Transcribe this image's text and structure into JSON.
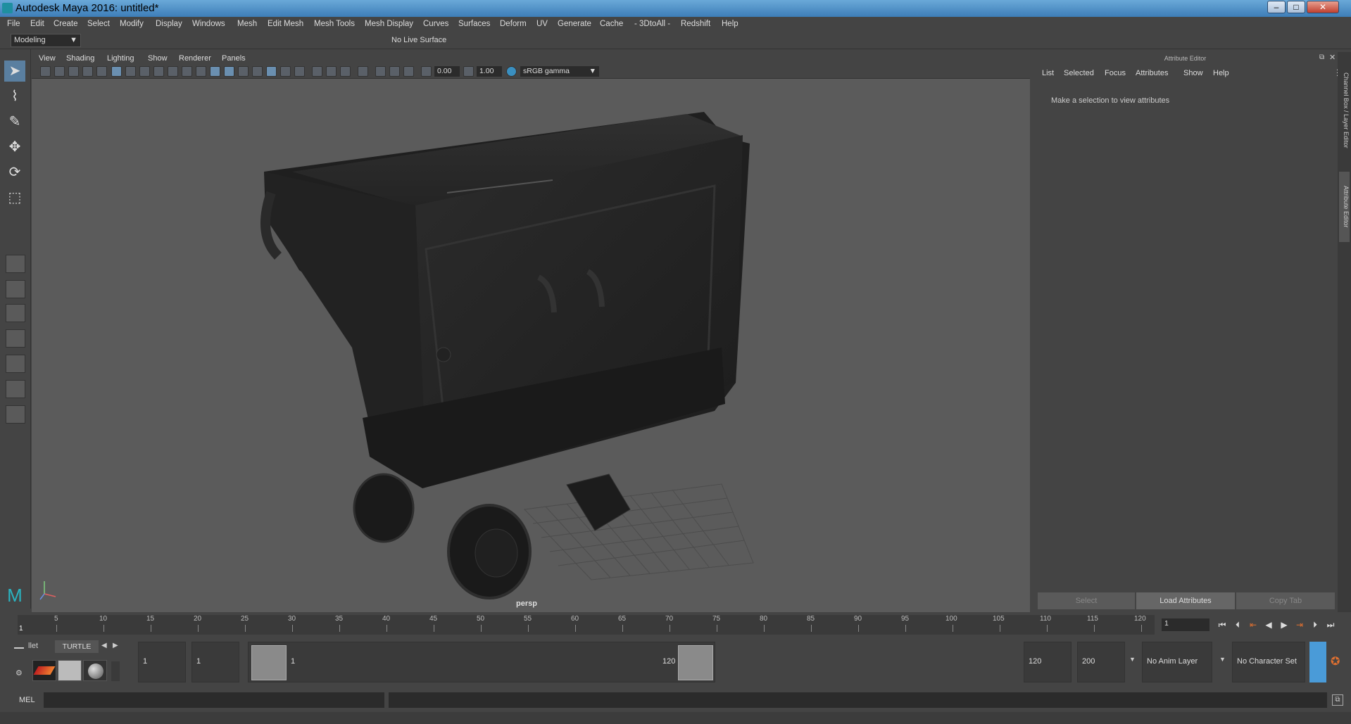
{
  "window": {
    "title": "Autodesk Maya 2016: untitled*"
  },
  "menus": [
    "File",
    "Edit",
    "Create",
    "Select",
    "Modify",
    "Display",
    "Windows",
    "Mesh",
    "Edit Mesh",
    "Mesh Tools",
    "Mesh Display",
    "Curves",
    "Surfaces",
    "Deform",
    "UV",
    "Generate",
    "Cache",
    "- 3DtoAll -",
    "Redshift",
    "Help"
  ],
  "shelf": {
    "mode": "Modeling",
    "live_surface": "No Live Surface"
  },
  "viewport": {
    "menus": [
      "View",
      "Shading",
      "Lighting",
      "Show",
      "Renderer",
      "Panels"
    ],
    "exposure": "0.00",
    "gamma": "1.00",
    "colorspace": "sRGB gamma",
    "camera": "persp"
  },
  "attribute_editor": {
    "header": "Attribute Editor",
    "tabs": [
      "List",
      "Selected",
      "Focus",
      "Attributes",
      "Show",
      "Help"
    ],
    "message": "Make a selection to view attributes",
    "buttons": [
      "Select",
      "Load Attributes",
      "Copy Tab"
    ]
  },
  "side_tabs": [
    "Channel Box / Layer Editor",
    "Attribute Editor"
  ],
  "timeline": {
    "ticks": [
      "5",
      "10",
      "15",
      "20",
      "25",
      "30",
      "35",
      "40",
      "45",
      "50",
      "55",
      "60",
      "65",
      "70",
      "75",
      "80",
      "85",
      "90",
      "95",
      "100",
      "105",
      "110",
      "115",
      "120"
    ],
    "current_frame_marker": "1",
    "current_frame": "1"
  },
  "range": {
    "shelf_tab1": "llet",
    "shelf_tab2": "TURTLE",
    "start": "1",
    "anim_start": "1",
    "range_start": "1",
    "range_end": "120",
    "end": "120",
    "anim_end": "200",
    "anim_layer": "No Anim Layer",
    "char_set": "No Character Set"
  },
  "mel": {
    "label": "MEL"
  },
  "colors": {
    "accent": "#4a9bd8",
    "viewport_bg": "#5b5b5b",
    "panel": "#444444"
  }
}
